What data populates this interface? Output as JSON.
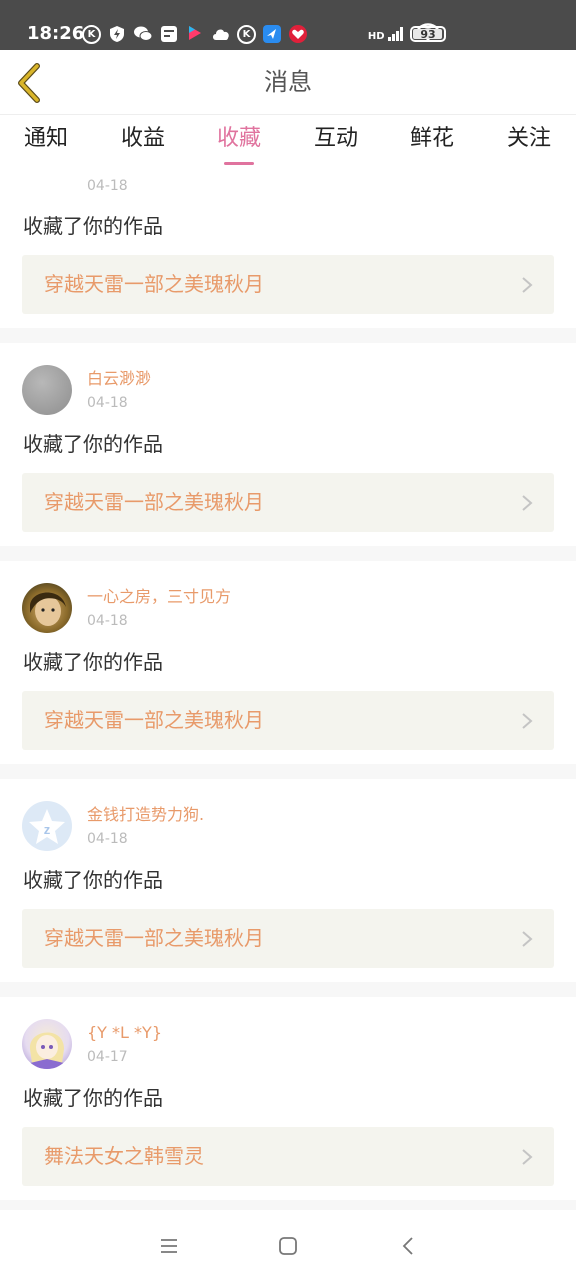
{
  "status_bar": {
    "time": "18:26",
    "battery": "93",
    "signal_label": "HD",
    "icons": [
      "k-icon",
      "bolt-icon",
      "wechat-icon",
      "note-icon",
      "video-icon",
      "cloud-icon",
      "k-icon",
      "bird-icon",
      "heart-icon"
    ]
  },
  "header": {
    "title": "消息",
    "back_icon": "chevron-left-icon",
    "accent": "#c9a227"
  },
  "tabs": [
    {
      "label": "通知",
      "active": false
    },
    {
      "label": "收益",
      "active": false
    },
    {
      "label": "收藏",
      "active": true
    },
    {
      "label": "互动",
      "active": false
    },
    {
      "label": "鲜花",
      "active": false
    },
    {
      "label": "关注",
      "active": false
    }
  ],
  "messages": [
    {
      "user": "",
      "date": "04-18",
      "text": "收藏了你的作品",
      "work": "穿越天雷一部之美瑰秋月",
      "avatar": "gray"
    },
    {
      "user": "白云渺渺",
      "date": "04-18",
      "text": "收藏了你的作品",
      "work": "穿越天雷一部之美瑰秋月",
      "avatar": "gray"
    },
    {
      "user": "一心之房，三寸见方",
      "date": "04-18",
      "text": "收藏了你的作品",
      "work": "穿越天雷一部之美瑰秋月",
      "avatar": "photo"
    },
    {
      "user": "金钱打造势力狗.",
      "date": "04-18",
      "text": "收藏了你的作品",
      "work": "穿越天雷一部之美瑰秋月",
      "avatar": "badge"
    },
    {
      "user": "{Y *L *Y}",
      "date": "04-17",
      "text": "收藏了你的作品",
      "work": "舞法天女之韩雪灵",
      "avatar": "anime"
    }
  ],
  "colors": {
    "accent_pink": "#e0739e",
    "name_orange": "#e89a6a",
    "link_bg": "#f4f4ee"
  },
  "navbar": {
    "icons": [
      "menu-icon",
      "home-square-icon",
      "back-icon"
    ]
  }
}
